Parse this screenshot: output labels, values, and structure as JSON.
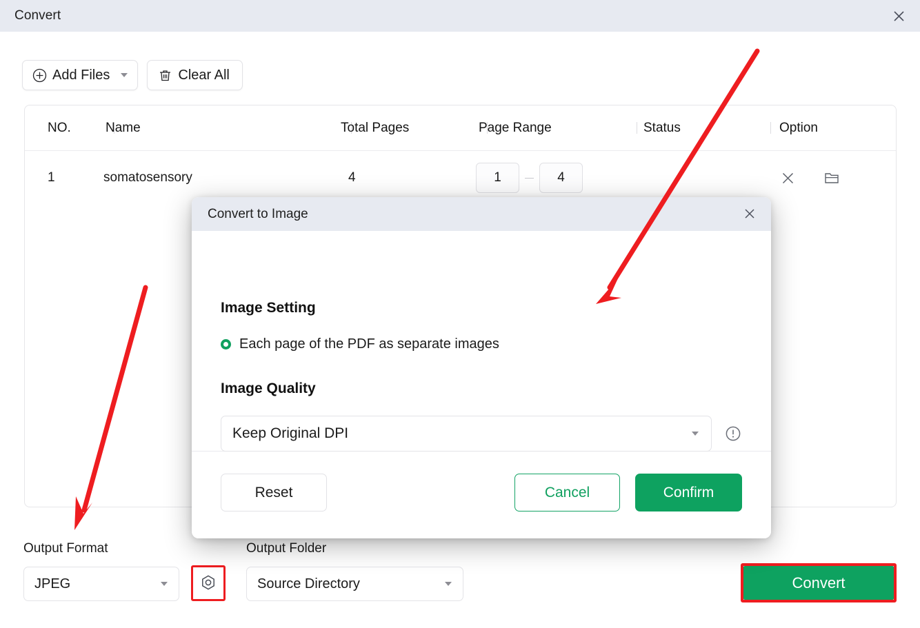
{
  "window": {
    "title": "Convert",
    "close_icon": "close-icon"
  },
  "toolbar": {
    "add_files_label": "Add Files",
    "add_files_icon": "plus-circle-icon",
    "add_files_caret": "chevron-down-icon",
    "clear_all_label": "Clear All",
    "clear_all_icon": "trash-icon"
  },
  "file_table": {
    "columns": [
      "NO.",
      "Name",
      "Total Pages",
      "Page Range",
      "Status",
      "Option"
    ],
    "rows": [
      {
        "no": "1",
        "name": "somatosensory",
        "total_pages": "4",
        "page_range_from": "1",
        "page_range_to": "4",
        "page_range_separator": "–",
        "status": "",
        "remove_icon": "close-icon",
        "folder_icon": "folder-icon"
      }
    ]
  },
  "bottom_bar": {
    "output_format_label": "Output Format",
    "output_format_value": "JPEG",
    "format_settings_icon": "hex-nut-settings-icon",
    "output_folder_label": "Output Folder",
    "output_folder_value": "Source Directory",
    "convert_label": "Convert"
  },
  "modal": {
    "title": "Convert to Image",
    "close_icon": "close-icon",
    "image_setting_heading": "Image Setting",
    "radio_option_label": "Each page of the PDF as separate images",
    "image_quality_heading": "Image Quality",
    "quality_value": "Keep Original DPI",
    "quality_caret": "chevron-down-icon",
    "quality_info_icon": "exclamation-circle-icon",
    "reset_label": "Reset",
    "cancel_label": "Cancel",
    "confirm_label": "Confirm"
  },
  "colors": {
    "accent_green": "#0ea260",
    "annotation_red": "#ee1d20",
    "titlebar": "#e7eaf1"
  }
}
